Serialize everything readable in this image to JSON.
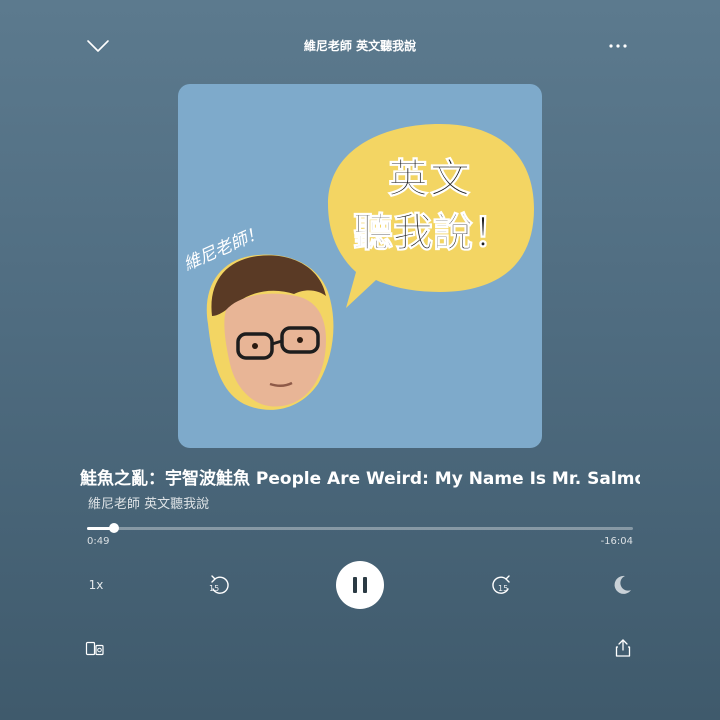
{
  "header": {
    "title": "維尼老師 英文聽我說",
    "collapse_icon": "chevron-down-icon",
    "more_icon": "more-options-icon"
  },
  "artwork": {
    "bubble_line1": "英文",
    "bubble_line2": "聽我說！",
    "signature": "維尼老師！"
  },
  "episode": {
    "title": "鮭魚之亂：宇智波鮭魚 People Are Weird: My Name Is Mr. Salmon",
    "show": "維尼老師 英文聽我說"
  },
  "playback": {
    "elapsed": "0:49",
    "remaining": "-16:04",
    "progress_fraction": 0.05,
    "speed": "1x",
    "skip_back_seconds": "15",
    "skip_forward_seconds": "15",
    "state": "playing"
  },
  "footer": {
    "connect_icon": "connect-device-icon",
    "share_icon": "share-icon"
  },
  "colors": {
    "background": "#587588",
    "artwork_bg": "#7eaacb",
    "bubble": "#f3d563",
    "accent": "#ffffff"
  }
}
